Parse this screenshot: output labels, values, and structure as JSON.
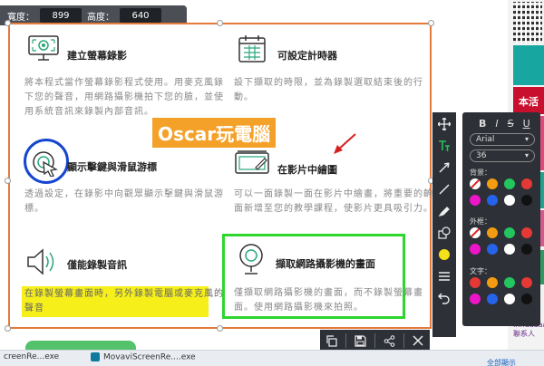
{
  "dimensions": {
    "width_label": "寬度：",
    "width_value": "899",
    "height_label": "高度：",
    "height_value": "640"
  },
  "features": [
    {
      "title": "建立螢幕錄影",
      "desc_lines": [
        "將本程式當作螢幕錄影程式使用。用麥克風錄",
        "下您的聲音，用網路攝影機拍下您的臉，並使",
        "用系統音訊來錄製內部音訊。"
      ],
      "icon": "screen-record-icon"
    },
    {
      "title": "可設定計時器",
      "desc_lines": [
        "設下擷取的時限，並為錄製選取結束後的行",
        "動。"
      ],
      "icon": "calendar-timer-icon"
    },
    {
      "title": "顯示擊鍵與滑鼠游標",
      "desc_lines": [
        "透過設定，在錄影中向觀眾顯示擊鍵與滑鼠游",
        "標。"
      ],
      "icon": "cursor-click-icon"
    },
    {
      "title": "在影片中繪圖",
      "desc_lines": [
        "可以一面錄製一面在影片中繪畫，將重要的齣",
        "面新增至您的教學課程，使影片更具吸引力。"
      ],
      "icon": "draw-on-video-icon"
    },
    {
      "title": "僅能錄製音訊",
      "desc_lines": [
        "在錄製螢幕畫面時，另外錄製電腦或麥克風的",
        "聲音"
      ],
      "icon": "speaker-audio-icon"
    },
    {
      "title": "擷取網路攝影機的畫面",
      "desc_lines": [
        "僅擷取網路攝影機的畫面，而不錄製螢幕畫",
        "面。使用網路攝影機來拍照。"
      ],
      "icon": "webcam-icon"
    }
  ],
  "watermark": "Oscar玩電腦",
  "format_panel": {
    "bold": "B",
    "italic": "I",
    "strike": "S",
    "underline": "U",
    "font": "Arial",
    "size": "36",
    "bg_label": "背景：",
    "border_label": "外框：",
    "text_label": "文字：",
    "bg_colors": [
      "none",
      "#f39c12",
      "#22c55e",
      "#e53935",
      "#ec16c8",
      "#2563eb",
      "#ffffff",
      "#111111"
    ],
    "border_colors": [
      "none",
      "#f39c12",
      "#22c55e",
      "#e53935",
      "#ec16c8",
      "#2563eb",
      "#ffffff",
      "#111111"
    ],
    "text_colors": [
      "#e53935",
      "#f39c12",
      "#22c55e",
      "#e53935",
      "#ec16c8",
      "#2563eb",
      "#ffffff",
      "#111111"
    ]
  },
  "taskbar": {
    "item1": "creenRe...exe",
    "item2": "MovaviScreenRe....exe",
    "link": "全部顯示"
  },
  "background": {
    "red_text": "本活",
    "side_text": "...nuaaaa 聯系人"
  }
}
